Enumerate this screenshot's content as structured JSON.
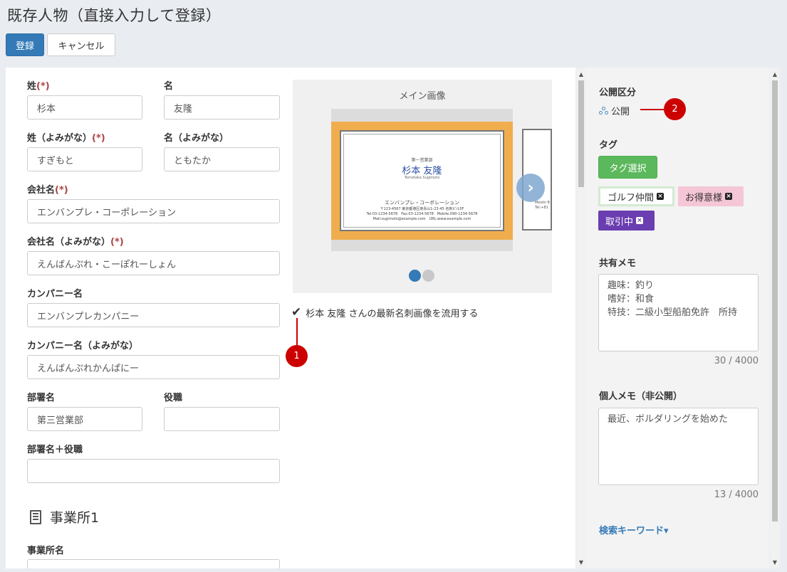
{
  "page": {
    "title": "既存人物（直接入力して登録）"
  },
  "actions": {
    "register": "登録",
    "cancel": "キャンセル"
  },
  "form": {
    "last_name_label": "姓",
    "first_name_label": "名",
    "required_mark": "(*)",
    "last_name_value": "杉本",
    "first_name_value": "友隆",
    "last_kana_label": "姓（よみがな）",
    "first_kana_label": "名（よみがな）",
    "last_kana_value": "すぎもと",
    "first_kana_value": "ともたか",
    "company_label": "会社名",
    "company_value": "エンバンプレ・コーポレーション",
    "company_kana_label": "会社名（よみがな）",
    "company_kana_value": "えんばんぷれ・こーぽれーしょん",
    "company_alt_label": "カンパニー名",
    "company_alt_value": "エンバンプレカンパニー",
    "company_alt_kana_label": "カンパニー名（よみがな）",
    "company_alt_kana_value": "えんばんぷれかんぱにー",
    "dept_label": "部署名",
    "dept_value": "第三営業部",
    "position_label": "役職",
    "position_value": "",
    "dept_position_label": "部署名＋役職",
    "dept_position_value": "",
    "office_heading": "事業所1",
    "office_name_label": "事業所名"
  },
  "image": {
    "caption": "メイン画像",
    "card_dept": "第一営業部",
    "card_name": "杉本 友隆",
    "card_roman": "Tomotaka Sugimoto",
    "card_company": "エンバンプレ・コーポレーション",
    "card_address": "〒123-4567 東京都港区南青山1-23-45 名刺ビル5F",
    "card_tel": "Tel:03-1234-5678　Fax:03-1234-5678　Mobile:090-1234-5678",
    "card_mail": "Mail:sugimoto@example.com　URL:www.example.com",
    "card2_line1": "Meishi B",
    "card2_line2": "Tel:+81",
    "reuse_text": "杉本 友隆 さんの最新名刺画像を流用する",
    "next_icon": "chevron-right-icon"
  },
  "markers": {
    "m1": "1",
    "m2": "2"
  },
  "side": {
    "visibility_label": "公開区分",
    "visibility_value": "公開",
    "tag_label": "タグ",
    "tag_button": "タグ選択",
    "tags": [
      "ゴルフ仲間",
      "お得意様",
      "取引中"
    ],
    "tag_remove": "×",
    "shared_memo_label": "共有メモ",
    "shared_memo_value": "趣味：釣り\n嗜好：和食\n特技：二級小型船舶免許　所持",
    "shared_memo_count": "30 / 4000",
    "private_memo_label": "個人メモ（非公開）",
    "private_memo_value": "最近、ボルダリングを始めた",
    "private_memo_count": "13 / 4000",
    "search_keyword_link": "検索キーワード▾"
  },
  "colors": {
    "primary": "#337ab7",
    "success": "#5cb85c",
    "marker": "#cc0000",
    "card_frame": "#f0ad4e",
    "tag_purple": "#6a3db0",
    "tag_pink": "#f5c6d6"
  }
}
